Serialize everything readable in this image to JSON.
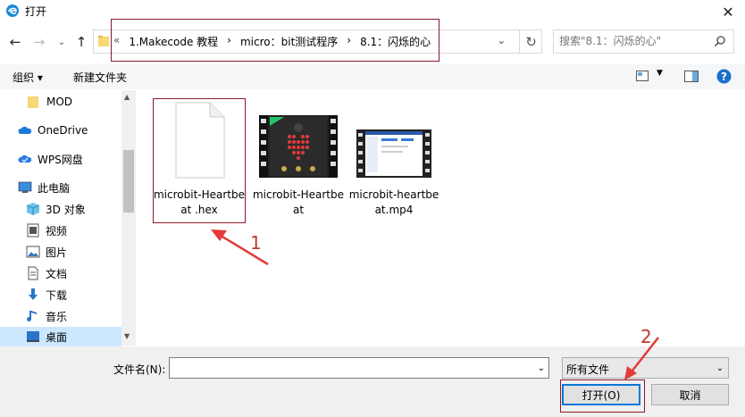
{
  "window": {
    "title": "打开",
    "close_glyph": "✕"
  },
  "nav": {
    "breadcrumbs": [
      "«",
      "1.Makecode 教程",
      "›",
      "micro：bit测试程序",
      "›",
      "8.1：闪烁的心",
      "⌄"
    ],
    "search_placeholder": "搜索\"8.1：闪烁的心\""
  },
  "toolbar": {
    "organize": "组织 ▾",
    "new_folder": "新建文件夹"
  },
  "sidebar": {
    "items": [
      {
        "label": "MOD",
        "icon": "folder-icon"
      },
      {
        "label": "OneDrive",
        "icon": "cloud-icon"
      },
      {
        "label": "WPS网盘",
        "icon": "wps-cloud-icon"
      },
      {
        "label": "此电脑",
        "icon": "computer-icon"
      },
      {
        "label": "3D 对象",
        "icon": "3d-objects-icon"
      },
      {
        "label": "视频",
        "icon": "video-icon"
      },
      {
        "label": "图片",
        "icon": "pictures-icon"
      },
      {
        "label": "文档",
        "icon": "documents-icon"
      },
      {
        "label": "下载",
        "icon": "download-icon"
      },
      {
        "label": "音乐",
        "icon": "music-icon"
      },
      {
        "label": "桌面",
        "icon": "desktop-icon"
      }
    ]
  },
  "files": [
    {
      "label": "microbit-Heartbeat .hex",
      "icon": "blank-file-icon"
    },
    {
      "label": "microbit-Heartbeat",
      "icon": "microbit-video-icon"
    },
    {
      "label": "microbit-heartbeat.mp4",
      "icon": "screen-video-icon"
    }
  ],
  "bottom": {
    "filename_label": "文件名(N):",
    "filename_value": "",
    "filetype_value": "所有文件",
    "open_label": "打开(O)",
    "cancel_label": "取消"
  },
  "annotations": {
    "step1": "1",
    "step2": "2",
    "color": "#c0392b"
  }
}
